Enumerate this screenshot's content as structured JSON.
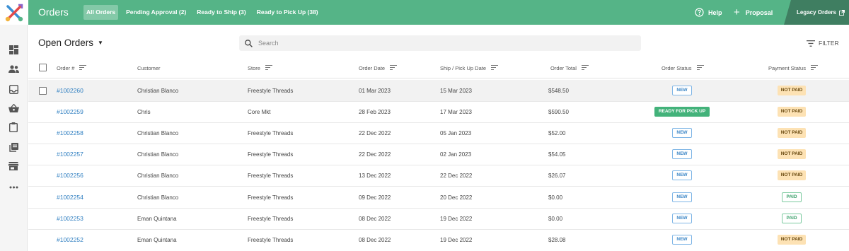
{
  "topbar": {
    "title": "Orders",
    "tabs": [
      "All Orders",
      "Pending Approval (2)",
      "Ready to Ship (3)",
      "Ready to Pick Up (38)"
    ],
    "active_tab": "All Orders",
    "help_label": "Help",
    "proposal_label": "Proposal",
    "legacy_label": "Legacy Orders"
  },
  "colors": {
    "brand_green": "#55b487",
    "legacy_green": "#3f7e61",
    "link_blue": "#2f7fc1",
    "ready_green": "#43b27a",
    "not_paid_bg": "#fde2b4"
  },
  "sidenav": {
    "icons": [
      "dashboard-icon",
      "people-icon",
      "inbox-icon",
      "basket-icon",
      "clipboard-icon",
      "catalog-icon",
      "store-icon",
      "more-icon"
    ]
  },
  "page": {
    "title": "Open Orders",
    "search_placeholder": "Search",
    "filter_label": "FILTER"
  },
  "table": {
    "columns": [
      "Order #",
      "Customer",
      "Store",
      "Order Date",
      "Ship / Pick Up Date",
      "Order Total",
      "Order Status",
      "Payment Status"
    ],
    "rows": [
      {
        "order": "#1002260",
        "customer": "Christian Blanco",
        "store": "Freestyle Threads",
        "order_date": "01 Mar 2023",
        "ship_date": "15 Mar 2023",
        "total": "$548.50",
        "status": "NEW",
        "payment": "NOT PAID"
      },
      {
        "order": "#1002259",
        "customer": "Chris",
        "store": "Core Mkt",
        "order_date": "28 Feb 2023",
        "ship_date": "17 Mar 2023",
        "total": "$590.50",
        "status": "READY FOR PICK UP",
        "payment": "NOT PAID"
      },
      {
        "order": "#1002258",
        "customer": "Christian Blanco",
        "store": "Freestyle Threads",
        "order_date": "22 Dec 2022",
        "ship_date": "05 Jan 2023",
        "total": "$52.00",
        "status": "NEW",
        "payment": "NOT PAID"
      },
      {
        "order": "#1002257",
        "customer": "Christian Blanco",
        "store": "Freestyle Threads",
        "order_date": "22 Dec 2022",
        "ship_date": "02 Jan 2023",
        "total": "$54.05",
        "status": "NEW",
        "payment": "NOT PAID"
      },
      {
        "order": "#1002256",
        "customer": "Christian Blanco",
        "store": "Freestyle Threads",
        "order_date": "13 Dec 2022",
        "ship_date": "22 Dec 2022",
        "total": "$26.07",
        "status": "NEW",
        "payment": "NOT PAID"
      },
      {
        "order": "#1002254",
        "customer": "Christian Blanco",
        "store": "Freestyle Threads",
        "order_date": "09 Dec 2022",
        "ship_date": "20 Dec 2022",
        "total": "$0.00",
        "status": "NEW",
        "payment": "PAID"
      },
      {
        "order": "#1002253",
        "customer": "Eman Quintana",
        "store": "Freestyle Threads",
        "order_date": "08 Dec 2022",
        "ship_date": "19 Dec 2022",
        "total": "$0.00",
        "status": "NEW",
        "payment": "PAID"
      },
      {
        "order": "#1002252",
        "customer": "Eman Quintana",
        "store": "Freestyle Threads",
        "order_date": "08 Dec 2022",
        "ship_date": "19 Dec 2022",
        "total": "$28.08",
        "status": "NEW",
        "payment": "NOT PAID"
      }
    ]
  }
}
